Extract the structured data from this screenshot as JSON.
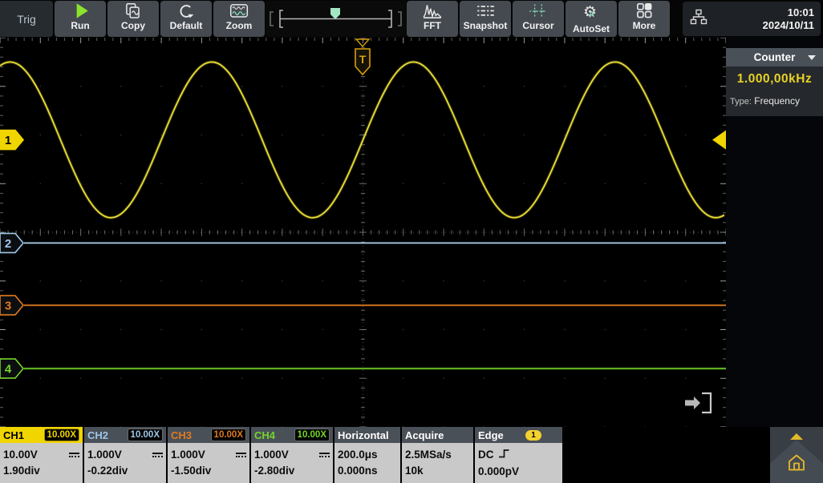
{
  "toolbar": {
    "trig_label": "Trig",
    "buttons_left": [
      {
        "label": "Run",
        "icon": "run-icon"
      },
      {
        "label": "Copy",
        "icon": "copy-icon"
      },
      {
        "label": "Default",
        "icon": "default-icon"
      },
      {
        "label": "Zoom",
        "icon": "zoom-icon"
      }
    ],
    "buttons_right": [
      {
        "label": "FFT",
        "icon": "fft-icon"
      },
      {
        "label": "Snapshot",
        "icon": "snapshot-icon"
      },
      {
        "label": "Cursor",
        "icon": "cursor-icon"
      },
      {
        "label": "AutoSet",
        "icon": "autoset-icon"
      },
      {
        "label": "More",
        "icon": "more-grid-icon"
      }
    ],
    "clock": {
      "time": "10:01",
      "date": "2024/10/11"
    }
  },
  "sidebar": {
    "counter": {
      "title": "Counter",
      "value": "1.000,00kHz",
      "type_label": "Type:",
      "type_value": "Frequency"
    }
  },
  "bottom": {
    "channels": [
      {
        "id": "CH1",
        "probe": "10.00X",
        "scale": "10.00V",
        "offset": "1.90div",
        "selected": true,
        "color": "#f0d500"
      },
      {
        "id": "CH2",
        "probe": "10.00X",
        "scale": "1.000V",
        "offset": "-0.22div",
        "selected": false,
        "color": "#9fc6e8"
      },
      {
        "id": "CH3",
        "probe": "10.00X",
        "scale": "1.000V",
        "offset": "-1.50div",
        "selected": false,
        "color": "#df7b20"
      },
      {
        "id": "CH4",
        "probe": "10.00X",
        "scale": "1.000V",
        "offset": "-2.80div",
        "selected": false,
        "color": "#74d629"
      }
    ],
    "horizontal": {
      "label": "Horizontal",
      "timebase": "200.0μs",
      "delay": "0.000ns"
    },
    "acquire": {
      "label": "Acquire",
      "sample_rate": "2.5MSa/s",
      "memory_depth": "10k"
    },
    "trigger": {
      "label": "Edge",
      "source_badge": "1",
      "coupling": "DC",
      "slope": "rising",
      "level": "0.000pV"
    }
  },
  "chart_data": {
    "type": "line",
    "title": "Oscilloscope waveform display",
    "grid": {
      "h_divisions": 18,
      "v_divisions": 8,
      "style": "center-crosshair with edge ticks and dot grid"
    },
    "timebase_per_div": "200.0μs",
    "measured_frequency": "1.000,00kHz",
    "series": [
      {
        "name": "CH1",
        "color": "#e9dd33",
        "waveform": "sine",
        "frequency": "1kHz",
        "period_div": 5,
        "amplitude_div": 1.6,
        "offset_div": 1.9,
        "volts_per_div": "10.00V"
      },
      {
        "name": "CH2",
        "color": "#a9cbe8",
        "waveform": "flat",
        "offset_div": -0.22,
        "volts_per_div": "1.000V"
      },
      {
        "name": "CH3",
        "color": "#df7b20",
        "waveform": "flat",
        "offset_div": -1.5,
        "volts_per_div": "1.000V"
      },
      {
        "name": "CH4",
        "color": "#74d629",
        "waveform": "flat",
        "offset_div": -2.8,
        "volts_per_div": "1.000V"
      }
    ],
    "channel_markers": [
      {
        "label": "1",
        "color": "#f0d500",
        "offset_div": 1.9,
        "filled": true
      },
      {
        "label": "2",
        "color": "#9fc6e8",
        "offset_div": -0.22,
        "filled": false
      },
      {
        "label": "3",
        "color": "#df7b20",
        "offset_div": -1.5,
        "filled": false
      },
      {
        "label": "4",
        "color": "#74d629",
        "offset_div": -2.8,
        "filled": false
      }
    ],
    "trigger_marker": {
      "label": "T",
      "color": "#d7a10c",
      "position": "center-top"
    },
    "trigger_level_marker": {
      "color": "#f0d500",
      "offset_div": 1.9,
      "edge": "right"
    }
  }
}
